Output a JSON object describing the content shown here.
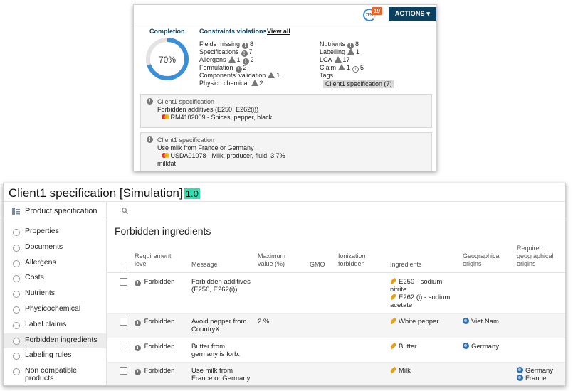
{
  "popup": {
    "completion_mini": "70%",
    "badge_count": "19",
    "actions_label": "ACTIONS ▾",
    "completion_title": "Completion",
    "completion_value": "70%",
    "completion_fraction": 0.7,
    "violations_title": "Constraints violations",
    "view_all": "View all",
    "violations_left": [
      {
        "label": "Fields missing",
        "icon": "exclamation-icon",
        "count": "8"
      },
      {
        "label": "Specifications",
        "icon": "exclamation-icon",
        "count": "7"
      },
      {
        "label": "Allergens",
        "icon": "warning-icon",
        "count": "1",
        "icon2": "exclamation-icon",
        "count2": "2"
      },
      {
        "label": "Formulation",
        "icon": "exclamation-icon",
        "count": "2"
      },
      {
        "label": "Components' validation",
        "icon": "warning-icon",
        "count": "1"
      },
      {
        "label": "Physico chemical",
        "icon": "warning-icon",
        "count": "2"
      }
    ],
    "violations_right": [
      {
        "label": "Nutrients",
        "icon": "exclamation-icon",
        "count": "8"
      },
      {
        "label": "Labelling",
        "icon": "warning-icon",
        "count": "1"
      },
      {
        "label": "LCA",
        "icon": "warning-icon",
        "count": "17"
      },
      {
        "label": "Claim",
        "icon": "warning-icon",
        "count": "1",
        "icon2": "info-icon",
        "count2": "5"
      }
    ],
    "tags_label": "Tags",
    "tag_chip": "Client1 specification (7)",
    "spec_items": [
      {
        "title": "Client1 specification",
        "message": "Forbidden additives (E250, E262(i))",
        "rm_line1": "RM4102009 - Spices, pepper, black",
        "rm_line2": ""
      },
      {
        "title": "Client1 specification",
        "message": "Use milk from France or Germany",
        "rm_line1": "USDA01078 - Milk, producer, fluid, 3.7%",
        "rm_line2": "milkfat"
      }
    ]
  },
  "main": {
    "title": "Client1 specification [Simulation]",
    "version": "1.0",
    "sidebar_header": "Product specification",
    "sidebar_items": [
      {
        "label": "Properties",
        "active": false
      },
      {
        "label": "Documents",
        "active": false
      },
      {
        "label": "Allergens",
        "active": false
      },
      {
        "label": "Costs",
        "active": false
      },
      {
        "label": "Nutrients",
        "active": false
      },
      {
        "label": "Physicochemical",
        "active": false
      },
      {
        "label": "Label claims",
        "active": false
      },
      {
        "label": "Forbidden ingredients",
        "active": true
      },
      {
        "label": "Labeling rules",
        "active": false
      },
      {
        "label": "Non compatible products",
        "active": false
      }
    ],
    "section_heading": "Forbidden ingredients",
    "columns": {
      "requirement": "Requirement level",
      "message": "Message",
      "max_value": "Maximum value (%)",
      "gmo": "GMO",
      "ionization": "Ionization forbidden",
      "ingredients": "Ingredients",
      "geo": "Geographical origins",
      "req_geo": "Required geographical origins"
    },
    "rows": [
      {
        "level": "Forbidden",
        "message": "Forbidden additives (E250, E262(i))",
        "max": "",
        "ingredients": [
          "E250 - sodium nitrite",
          "E262 (i) - sodium acetate"
        ],
        "geo": [],
        "req_geo": []
      },
      {
        "level": "Forbidden",
        "message": "Avoid pepper from CountryX",
        "max": "2 %",
        "ingredients": [
          "White pepper"
        ],
        "geo": [
          "Viet Nam"
        ],
        "req_geo": []
      },
      {
        "level": "Forbidden",
        "message": "Butter from germany is forb.",
        "max": "",
        "ingredients": [
          "Butter"
        ],
        "geo": [
          "Germany"
        ],
        "req_geo": []
      },
      {
        "level": "Forbidden",
        "message": "Use milk from France or Germany",
        "max": "",
        "ingredients": [
          "Milk"
        ],
        "geo": [],
        "req_geo": [
          "Germany",
          "France"
        ]
      }
    ]
  }
}
